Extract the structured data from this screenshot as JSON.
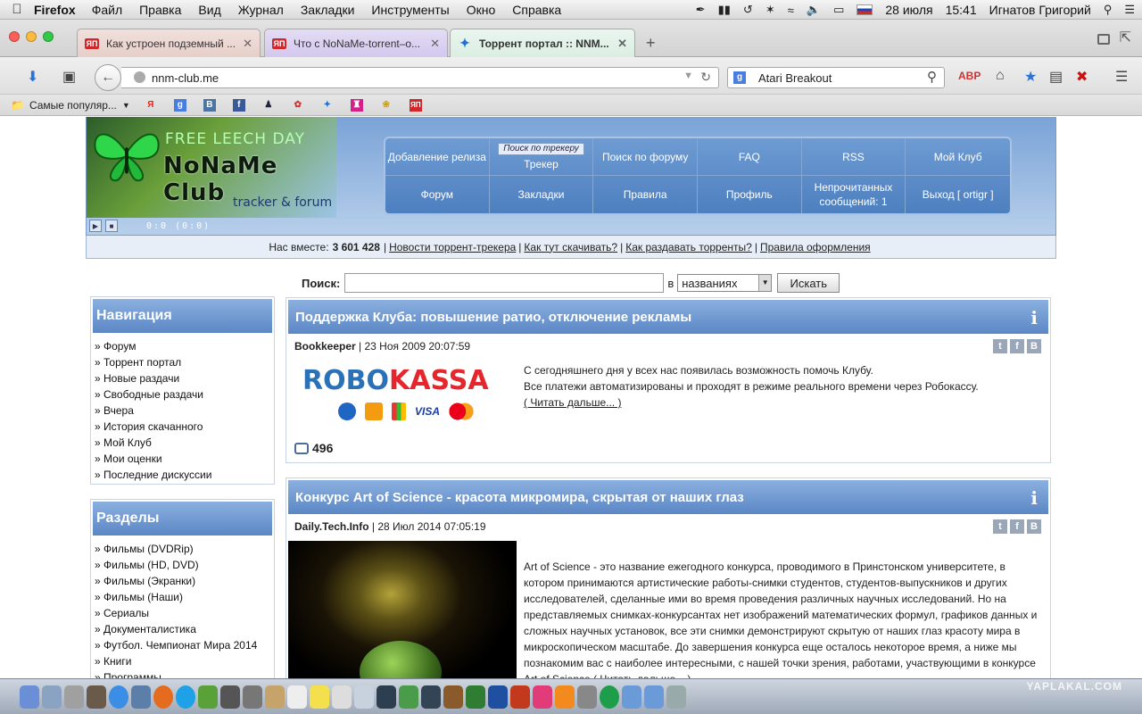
{
  "menubar": {
    "app": "Firefox",
    "items": [
      "Файл",
      "Правка",
      "Вид",
      "Журнал",
      "Закладки",
      "Инструменты",
      "Окно",
      "Справка"
    ],
    "date": "28 июля",
    "time": "15:41",
    "user": "Игнатов Григорий"
  },
  "tabs": [
    {
      "title": "Как устроен подземный ..."
    },
    {
      "title": "Что с NoNaMe-torrent–о..."
    },
    {
      "title": "Торрент портал :: NNM..."
    }
  ],
  "nav": {
    "url": "nnm-club.me",
    "search_value": "Atari Breakout"
  },
  "bookmarks": {
    "first": "Самые популяр..."
  },
  "header": {
    "promo": "FREE LEECH DAY",
    "logo": "NoNaMe Club",
    "tagline": "tracker & forum",
    "player_time": "0:0 (0:0)"
  },
  "menu": {
    "row1": [
      {
        "label": "Добавление релиза"
      },
      {
        "mini": "Поиск по трекеру",
        "label": "Трекер"
      },
      {
        "label": "Поиск по форуму"
      },
      {
        "label": "FAQ"
      },
      {
        "label": "RSS"
      },
      {
        "label": "Мой Клуб"
      }
    ],
    "row2": [
      {
        "label": "Форум"
      },
      {
        "label": "Закладки"
      },
      {
        "label": "Правила"
      },
      {
        "label": "Профиль"
      },
      {
        "label": "Непрочитанных сообщений: 1"
      },
      {
        "label": "Выход [ ortigr ]"
      }
    ]
  },
  "infobar": {
    "prefix": "Нас вместе:",
    "count": "3 601 428",
    "links": [
      "Новости торрент-трекера",
      "Как тут скачивать?",
      "Как раздавать торренты?",
      "Правила оформления"
    ]
  },
  "search": {
    "label": "Поиск:",
    "in": "в",
    "option": "названиях",
    "button": "Искать"
  },
  "sidebar": {
    "nav_title": "Навигация",
    "nav_items": [
      "» Форум",
      "» Торрент портал",
      "» Новые раздачи",
      "» Свободные раздачи",
      "» Вчера",
      "» История скачанного",
      "» Мой Клуб",
      "» Мои оценки",
      "» Последние дискуссии"
    ],
    "sections_title": "Разделы",
    "section_items": [
      "» Фильмы (DVDRip)",
      "» Фильмы (HD, DVD)",
      "» Фильмы (Экранки)",
      "» Фильмы (Наши)",
      "» Сериалы",
      "» Документалистика",
      "» Футбол. Чемпионат Мира 2014",
      "» Книги",
      "» Программы"
    ]
  },
  "articles": [
    {
      "title": "Поддержка Клуба: повышение ратио, отключение рекламы",
      "author": "Bookkeeper",
      "date": "23 Ноя 2009 20:07:59",
      "lines": [
        "С сегодняшнего дня у всех нас появилась возможность помочь Клубу.",
        "Все платежи автоматизированы и проходят в режиме реального времени через Робокассу."
      ],
      "more": "( Читать дальше... )",
      "comments": "496",
      "logo_a": "ROBO",
      "logo_b": "KASSA",
      "visa": "VISA"
    },
    {
      "title": "Конкурс Art of Science - красота микромира, скрытая от наших глаз",
      "author": "Daily.Tech.Info",
      "date": "28 Июл 2014 07:05:19",
      "text": "Art of Science - это название ежегодного конкурса, проводимого в Принстонском университете, в котором принимаются артистические работы-снимки студентов, студентов-выпускников и других исследователей, сделанные ими во время проведения различных научных исследований. Но на представляемых снимках-конкурсантах нет изображений математических формул, графиков данных и сложных научных установок, все эти снимки демонстрируют скрытую от наших глаз красоту мира в микроскопическом масштабе. До завершения конкурса еще осталось некоторое время, а ниже мы познакомим вас с наиболее интересными, с нашей точки зрения, работами, участвующими в конкурсе Art of Science ( Читать дальше... )"
    }
  ],
  "watermark": "YAPLAKAL.COM"
}
